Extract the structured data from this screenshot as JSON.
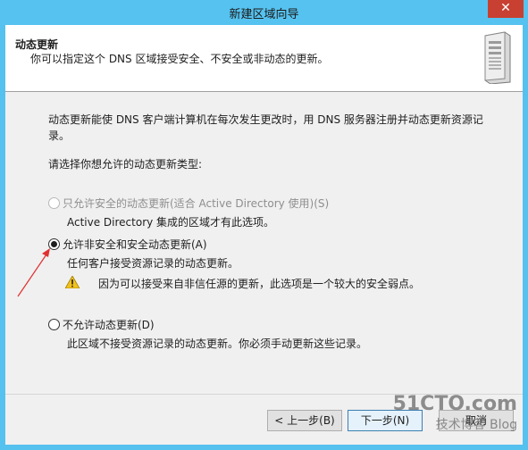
{
  "window": {
    "title": "新建区域向导",
    "close_glyph": "✕"
  },
  "header": {
    "title": "动态更新",
    "subtitle": "你可以指定这个 DNS 区域接受安全、不安全或非动态的更新。",
    "icon": "server-icon"
  },
  "body": {
    "description_line1": "动态更新能使 DNS 客户端计算机在每次发生更改时，用 DNS 服务器注册并动态更新资源记",
    "description_line2": "录。",
    "prompt": "请选择你想允许的动态更新类型:",
    "options": [
      {
        "label": "只允许安全的动态更新(适合 Active Directory 使用)(S)",
        "description": "Active Directory 集成的区域才有此选项。",
        "selected": false,
        "enabled": false
      },
      {
        "label": "允许非安全和安全动态更新(A)",
        "description": "任何客户接受资源记录的动态更新。",
        "warning": "因为可以接受来自非信任源的更新，此选项是一个较大的安全弱点。",
        "selected": true,
        "enabled": true
      },
      {
        "label": "不允许动态更新(D)",
        "description": "此区域不接受资源记录的动态更新。你必须手动更新这些记录。",
        "selected": false,
        "enabled": true
      }
    ]
  },
  "footer": {
    "back_label": "< 上一步(B)",
    "next_label": "下一步(N)",
    "cancel_label": "取消"
  },
  "watermark": {
    "line1": "51CTO.com",
    "line2": "技术博客 Blog"
  },
  "colors": {
    "titlebar": "#56c2ef",
    "close": "#c84031",
    "annotation_arrow": "#e03030"
  }
}
